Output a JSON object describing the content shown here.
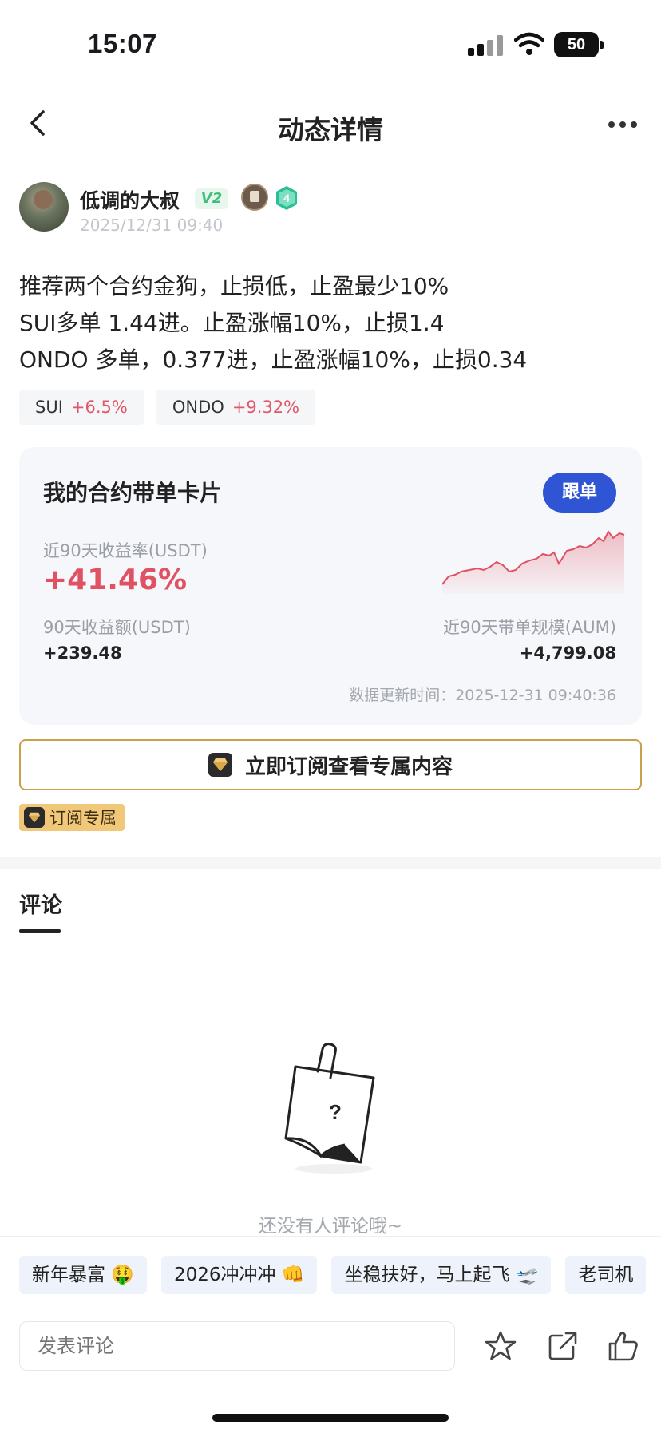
{
  "status_bar": {
    "time": "15:07",
    "battery": "50"
  },
  "nav": {
    "title": "动态详情"
  },
  "author": {
    "name": "低调的大叔",
    "vip": "V2",
    "level": "4",
    "time": "2025/12/31 09:40"
  },
  "post": {
    "lines": [
      "推荐两个合约金狗，止损低，止盈最少10%",
      "SUI多单 1.44进。止盈涨幅10%，止损1.4",
      "ONDO 多单，0.377进，止盈涨幅10%，止损0.34"
    ],
    "coins": [
      {
        "symbol": "SUI",
        "change": "+6.5%"
      },
      {
        "symbol": "ONDO",
        "change": "+9.32%"
      }
    ]
  },
  "card": {
    "title": "我的合约带单卡片",
    "follow_label": "跟单",
    "roi_label": "近90天收益率(USDT)",
    "roi_value": "+41.46%",
    "pnl_label": "90天收益额(USDT)",
    "pnl_value": "+239.48",
    "aum_label": "近90天带单规模(AUM)",
    "aum_value": "+4,799.08",
    "update_time": "数据更新时间：2025-12-31 09:40:36"
  },
  "subscribe": {
    "button_label": "立即订阅查看专属内容",
    "badge_label": "订阅专属"
  },
  "comments": {
    "tab_label": "评论",
    "empty_text": "还没有人评论哦~"
  },
  "bottom": {
    "chips": [
      "新年暴富 🤑",
      "2026冲冲冲 👊",
      "坐稳扶好，马上起飞 🛫",
      "老司机"
    ],
    "input_placeholder": "发表评论"
  },
  "colors": {
    "accent_blue": "#2f55d4",
    "up_red": "#e05263",
    "gold": "#c8a24b"
  }
}
